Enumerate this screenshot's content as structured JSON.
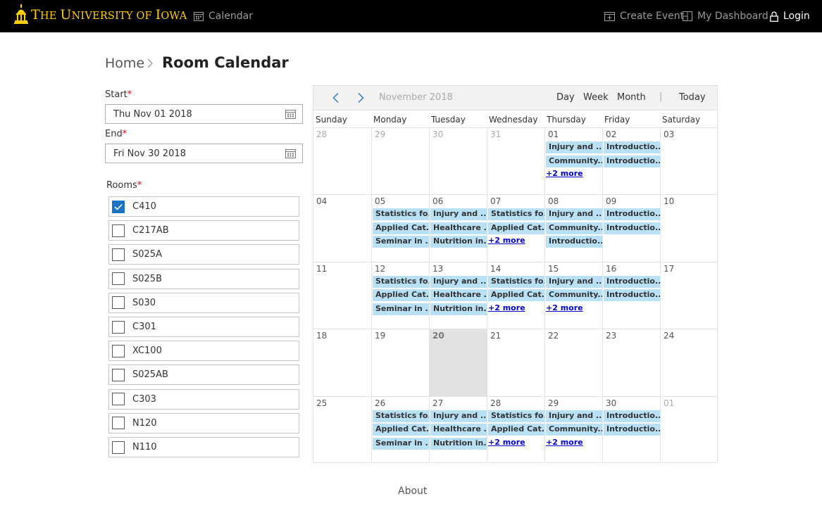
{
  "header": {
    "logo_main": "The University of Iowa",
    "logo_parts": [
      "T",
      "HE ",
      "U",
      "NIVERSITY OF ",
      "I",
      "OWA"
    ],
    "nav": {
      "calendar": "Calendar",
      "create_event": "Create Event",
      "dashboard": "My Dashboard",
      "login": "Login"
    }
  },
  "breadcrumb": {
    "home": "Home",
    "current": "Room Calendar"
  },
  "filters": {
    "start_label": "Start",
    "start_value": "Thu Nov 01 2018",
    "end_label": "End",
    "end_value": "Fri Nov 30 2018",
    "required_mark": "*",
    "rooms_label": "Rooms",
    "rooms": [
      {
        "name": "C410",
        "checked": true
      },
      {
        "name": "C217AB",
        "checked": false
      },
      {
        "name": "S025A",
        "checked": false
      },
      {
        "name": "S025B",
        "checked": false
      },
      {
        "name": "S030",
        "checked": false
      },
      {
        "name": "C301",
        "checked": false
      },
      {
        "name": "XC100",
        "checked": false
      },
      {
        "name": "S025AB",
        "checked": false
      },
      {
        "name": "C303",
        "checked": false
      },
      {
        "name": "N120",
        "checked": false
      },
      {
        "name": "N110",
        "checked": false
      }
    ]
  },
  "calendar": {
    "month_label": "November 2018",
    "views": {
      "day": "Day",
      "week": "Week",
      "month": "Month",
      "today": "Today"
    },
    "divider": "|",
    "weekdays": [
      "Sunday",
      "Monday",
      "Tuesday",
      "Wednesday",
      "Thursday",
      "Friday",
      "Saturday"
    ],
    "weeks": [
      [
        {
          "day": "28",
          "other": true,
          "events": []
        },
        {
          "day": "29",
          "other": true,
          "events": []
        },
        {
          "day": "30",
          "other": true,
          "events": []
        },
        {
          "day": "31",
          "other": true,
          "events": []
        },
        {
          "day": "01",
          "events": [
            "Injury and ...",
            "Community..."
          ],
          "more": "+2 more"
        },
        {
          "day": "02",
          "events": [
            "Introductio...",
            "Introductio..."
          ]
        },
        {
          "day": "03",
          "events": []
        }
      ],
      [
        {
          "day": "04",
          "events": []
        },
        {
          "day": "05",
          "events": [
            "Statistics fo...",
            "Applied Cat...",
            "Seminar in ..."
          ]
        },
        {
          "day": "06",
          "events": [
            "Injury and ...",
            "Healthcare ...",
            "Nutrition in..."
          ]
        },
        {
          "day": "07",
          "events": [
            "Statistics fo...",
            "Applied Cat..."
          ],
          "more": "+2 more"
        },
        {
          "day": "08",
          "events": [
            "Injury and ...",
            "Community...",
            "Introductio..."
          ]
        },
        {
          "day": "09",
          "events": [
            "Introductio...",
            "Introductio..."
          ]
        },
        {
          "day": "10",
          "events": []
        }
      ],
      [
        {
          "day": "11",
          "events": []
        },
        {
          "day": "12",
          "events": [
            "Statistics fo...",
            "Applied Cat...",
            "Seminar in ..."
          ]
        },
        {
          "day": "13",
          "events": [
            "Injury and ...",
            "Healthcare ...",
            "Nutrition in..."
          ]
        },
        {
          "day": "14",
          "events": [
            "Statistics fo...",
            "Applied Cat..."
          ],
          "more": "+2 more"
        },
        {
          "day": "15",
          "events": [
            "Injury and ...",
            "Community..."
          ],
          "more": "+2 more"
        },
        {
          "day": "16",
          "events": [
            "Introductio...",
            "Introductio..."
          ]
        },
        {
          "day": "17",
          "events": []
        }
      ],
      [
        {
          "day": "18",
          "events": []
        },
        {
          "day": "19",
          "events": []
        },
        {
          "day": "20",
          "today": true,
          "events": []
        },
        {
          "day": "21",
          "events": []
        },
        {
          "day": "22",
          "events": []
        },
        {
          "day": "23",
          "events": []
        },
        {
          "day": "24",
          "events": []
        }
      ],
      [
        {
          "day": "25",
          "events": []
        },
        {
          "day": "26",
          "events": [
            "Statistics fo...",
            "Applied Cat...",
            "Seminar in ..."
          ]
        },
        {
          "day": "27",
          "events": [
            "Injury and ...",
            "Healthcare ...",
            "Nutrition in..."
          ]
        },
        {
          "day": "28",
          "events": [
            "Statistics fo...",
            "Applied Cat..."
          ],
          "more": "+2 more"
        },
        {
          "day": "29",
          "events": [
            "Injury and ...",
            "Community..."
          ],
          "more": "+2 more"
        },
        {
          "day": "30",
          "events": [
            "Introductio...",
            "Introductio..."
          ]
        },
        {
          "day": "01",
          "other": true,
          "events": []
        }
      ]
    ]
  },
  "footer": {
    "about": "About"
  },
  "colors": {
    "brand_gold": "#FFCD00",
    "topbar_bg": "#000000",
    "event_bg": "#b8e0f6",
    "today_bg": "#e2e2e2",
    "checkbox_on": "#1a73c9",
    "more_link": "#0000cc"
  },
  "icons": {
    "logo": "old-capitol-dome-icon",
    "calendar": "calendar-icon",
    "create_event": "calendar-plus-icon",
    "dashboard": "dashboard-grid-icon",
    "login": "lock-icon",
    "breadcrumb_sep": "chevron-right-icon",
    "date_picker": "calendar-icon",
    "prev": "chevron-left-icon",
    "next": "chevron-right-icon",
    "check": "checkmark-icon"
  }
}
